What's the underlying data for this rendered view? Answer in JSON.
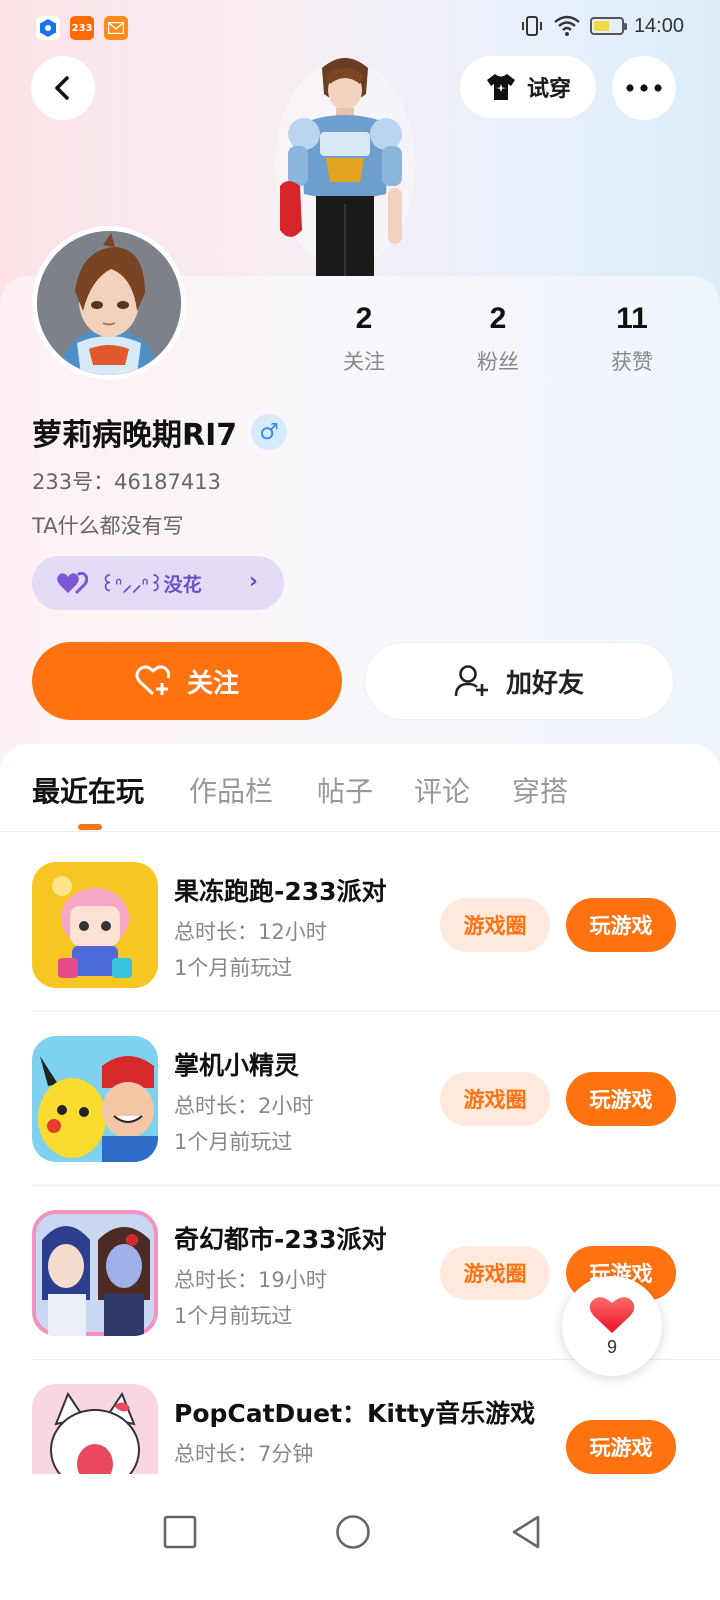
{
  "status_bar": {
    "time": "14:00",
    "app_badge": "233"
  },
  "header": {
    "try_on_label": "试穿"
  },
  "profile": {
    "nickname": "萝莉病晚期RI7",
    "gender_symbol": "♂",
    "uid_text": "233号：46187413",
    "bio": "TA什么都没有写",
    "tag_text": "꒰ᐢ⸝⸝ᐢ꒱没花",
    "stats": [
      {
        "value": "2",
        "label": "关注"
      },
      {
        "value": "2",
        "label": "粉丝"
      },
      {
        "value": "11",
        "label": "获赞"
      }
    ],
    "follow_label": "关注",
    "add_friend_label": "加好友"
  },
  "tabs": [
    {
      "label": "最近在玩",
      "active": true
    },
    {
      "label": "作品栏",
      "active": false
    },
    {
      "label": "帖子",
      "active": false
    },
    {
      "label": "评论",
      "active": false
    },
    {
      "label": "穿搭",
      "active": false
    }
  ],
  "games": [
    {
      "title": "果冻跑跑-233派对",
      "duration": "总时长：12小时",
      "last_played": "1个月前玩过",
      "circle_label": "游戏圈",
      "play_label": "玩游戏",
      "has_circle": true
    },
    {
      "title": "掌机小精灵",
      "duration": "总时长：2小时",
      "last_played": "1个月前玩过",
      "circle_label": "游戏圈",
      "play_label": "玩游戏",
      "has_circle": true
    },
    {
      "title": "奇幻都市-233派对",
      "duration": "总时长：19小时",
      "last_played": "1个月前玩过",
      "circle_label": "游戏圈",
      "play_label": "玩游戏",
      "has_circle": true
    },
    {
      "title": "PopCatDuet：Kitty音乐游戏",
      "duration": "总时长：7分钟",
      "last_played": "",
      "circle_label": "",
      "play_label": "玩游戏",
      "has_circle": false
    }
  ],
  "like_fab": {
    "count": "9"
  },
  "colors": {
    "accent": "#ff7210",
    "accent_soft": "#ffe9dc",
    "tag_bg": "#e4dcf6",
    "tag_text": "#6a4fc8"
  },
  "icons": [
    "back-arrow-icon",
    "tshirt-icon",
    "more-icon",
    "heart-plus-icon",
    "user-plus-icon",
    "heart-icon",
    "nav-recent-icon",
    "nav-home-icon",
    "nav-back-icon"
  ]
}
